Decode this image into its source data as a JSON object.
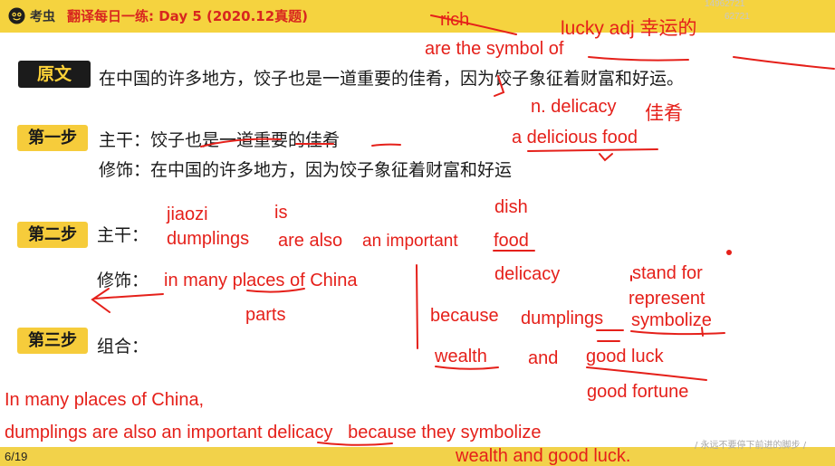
{
  "header": {
    "logo_text": "考虫",
    "lesson_title": "翻译每日一练: Day 5 (2020.12真题)",
    "id_text_1": "14962721",
    "id_text_2": "62721"
  },
  "steps": {
    "original_label": "原文",
    "original_text": "在中国的许多地方，饺子也是一道重要的佳肴，因为饺子象征着财富和好运。",
    "step1_label": "第一步",
    "step1_main": "主干：饺子也是一道重要的佳肴",
    "step1_modifier": "修饰：在中国的许多地方，因为饺子象征着财富和好运",
    "step2_label": "第二步",
    "step2_main_label": "主干：",
    "step2_modifier_label": "修饰：",
    "step3_label": "第三步",
    "step3_combine_label": "组合："
  },
  "annotations": {
    "rich": "rich",
    "lucky": "lucky  adj 幸运的",
    "symbol_of": "are the symbol of",
    "n_delicacy": "n. delicacy",
    "jiayao": "佳肴",
    "delicious_food": "a delicious food",
    "jiaozi": "jiaozi",
    "is": "is",
    "dish": "dish",
    "dumplings": "dumplings",
    "are_also": "are also",
    "an_important": "an important",
    "food": "food",
    "delicacy": "delicacy",
    "stand_for": "stand for",
    "represent": "represent",
    "in_many_places": "in many places of China",
    "parts": "parts",
    "because": "because",
    "dumplings2": "dumplings",
    "symbolize": "symbolize",
    "wealth": "wealth",
    "and": "and",
    "good_luck": "good luck",
    "good_fortune": "good fortune",
    "final_line1": "In many places of China,",
    "final_line2": "dumplings are also an important delicacy   because they symbolize",
    "final_line3": "wealth and good luck."
  },
  "footer": {
    "page_number": "6/19",
    "slogan": "/ 永远不要停下前进的脚步 /"
  }
}
